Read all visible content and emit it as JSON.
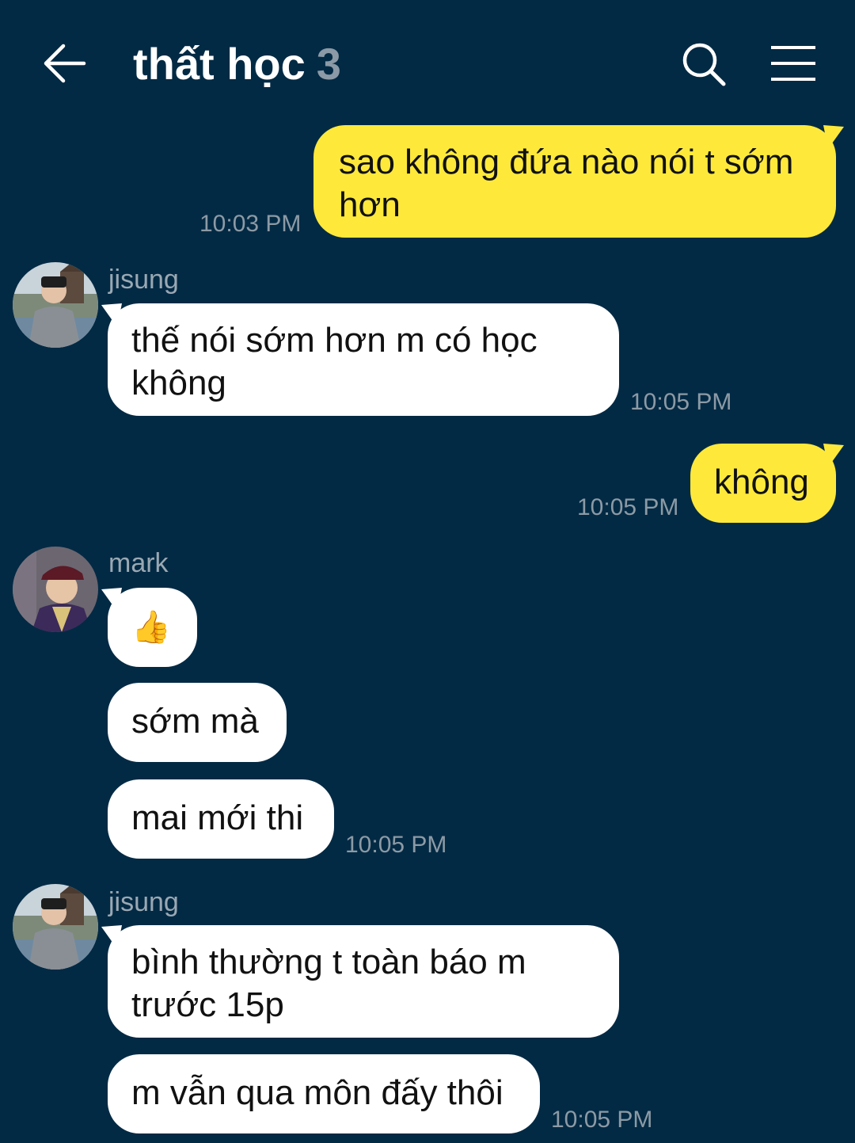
{
  "header": {
    "title": "thất học",
    "member_count": "3",
    "back_icon": "arrow-left-icon",
    "search_icon": "search-icon",
    "menu_icon": "hamburger-menu-icon"
  },
  "colors": {
    "background": "#032a44",
    "my_bubble": "#fee93b",
    "their_bubble": "#ffffff"
  },
  "messages": [
    {
      "text": "sao không đứa nào nói t sớm hơn",
      "time": "10:03 PM"
    },
    {
      "sender": "jisung",
      "text": "thế nói sớm hơn m có học không",
      "time": "10:05 PM"
    },
    {
      "text": "không",
      "time": "10:05 PM"
    },
    {
      "sender": "mark",
      "text": "👍"
    },
    {
      "text": "sớm mà"
    },
    {
      "text": "mai mới thi",
      "time": "10:05 PM"
    },
    {
      "sender": "jisung",
      "text": "bình thường t toàn báo m trước 15p"
    },
    {
      "text": "m vẫn qua môn đấy thôi",
      "time": "10:05 PM"
    }
  ]
}
